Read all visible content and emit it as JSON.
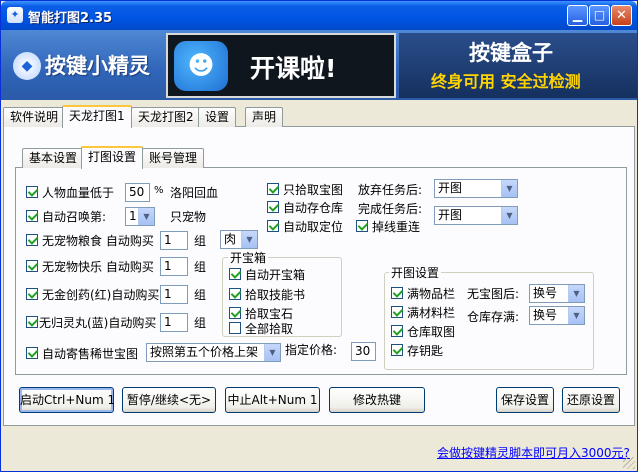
{
  "window": {
    "title": "智能打图2.35",
    "title_icon": "app-icon"
  },
  "banner": {
    "brand_name": "按键小精灵",
    "ad_text": "开课啦!",
    "box_title": "按键盒子",
    "box_subtitle": "终身可用 安全过检测"
  },
  "tabs": [
    "软件说明",
    "天龙打图1",
    "天龙打图2",
    "设置",
    "声明"
  ],
  "subtabs": [
    "基本设置",
    "打图设置",
    "账号管理"
  ],
  "left": {
    "hp_label": "人物血量低于",
    "hp_value": "50",
    "hp_unit": "%",
    "hp_action": "洛阳回血",
    "summon_label": "自动召唤第:",
    "summon_value": "1",
    "summon_unit": "只宠物",
    "petfood_label": "无宠物粮食 自动购买",
    "petfood_qty": "1",
    "petfood_unit": "组",
    "petfood_type": "肉",
    "petjoy_label": "无宠物快乐 自动购买",
    "petjoy_qty": "1",
    "petjoy_unit": "组",
    "redpill_label": "无金创药(红)自动购买",
    "redpill_qty": "1",
    "redpill_unit": "组",
    "bluepill_label": "无归灵丸(蓝)自动购买",
    "bluepill_qty": "1",
    "bluepill_unit": "组",
    "consign_label": "自动寄售稀世宝图",
    "consign_mode": "按照第五个价格上架",
    "price_label": "指定价格:",
    "price_value": "30"
  },
  "middle": {
    "pick_map": "只拾取宝图",
    "auto_store": "自动存仓库",
    "auto_locate": "自动取定位",
    "reconnect": "掉线重连",
    "abandon_label": "放弃任务后:",
    "abandon_value": "开图",
    "complete_label": "完成任务后:",
    "complete_value": "开图"
  },
  "chest_group": {
    "title": "开宝箱",
    "items": [
      "自动开宝箱",
      "拾取技能书",
      "拾取宝石",
      "全部拾取"
    ]
  },
  "open_group": {
    "title": "开图设置",
    "full_items": "满物品栏",
    "full_materials": "满材料栏",
    "store_map": "仓库取图",
    "deposit_key": "存钥匙",
    "no_map_label": "无宝图后:",
    "no_map_value": "换号",
    "warehouse_label": "仓库存满:",
    "warehouse_value": "换号"
  },
  "buttons": {
    "start": "启动Ctrl+Num 1",
    "pause": "暂停/继续<无>",
    "stop": "中止Alt+Num 1",
    "hotkey": "修改热键",
    "save": "保存设置",
    "restore": "还原设置"
  },
  "footer": {
    "link": "会做按键精灵脚本即可月入3000元?"
  }
}
